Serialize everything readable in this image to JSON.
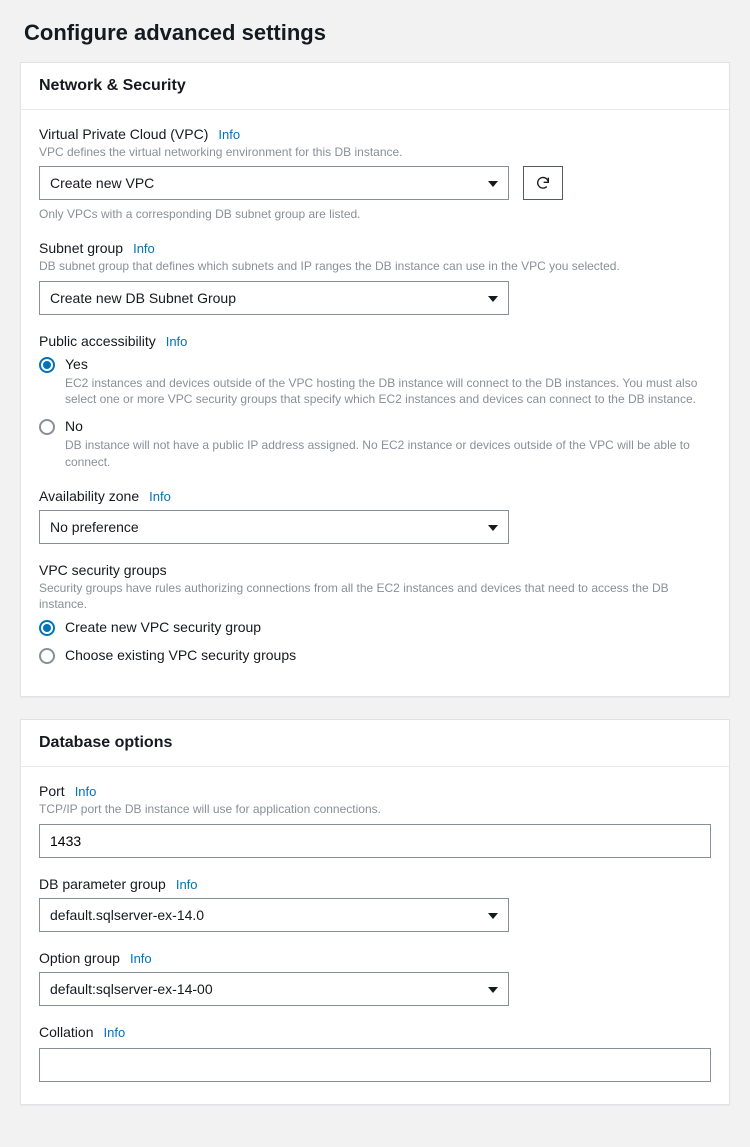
{
  "page": {
    "title": "Configure advanced settings"
  },
  "network": {
    "panel_title": "Network & Security",
    "vpc": {
      "label": "Virtual Private Cloud (VPC)",
      "info": "Info",
      "desc": "VPC defines the virtual networking environment for this DB instance.",
      "value": "Create new VPC",
      "hint": "Only VPCs with a corresponding DB subnet group are listed."
    },
    "subnet": {
      "label": "Subnet group",
      "info": "Info",
      "desc": "DB subnet group that defines which subnets and IP ranges the DB instance can use in the VPC you selected.",
      "value": "Create new DB Subnet Group"
    },
    "public": {
      "label": "Public accessibility",
      "info": "Info",
      "yes_label": "Yes",
      "yes_desc": "EC2 instances and devices outside of the VPC hosting the DB instance will connect to the DB instances. You must also select one or more VPC security groups that specify which EC2 instances and devices can connect to the DB instance.",
      "no_label": "No",
      "no_desc": "DB instance will not have a public IP address assigned. No EC2 instance or devices outside of the VPC will be able to connect."
    },
    "az": {
      "label": "Availability zone",
      "info": "Info",
      "value": "No preference"
    },
    "sg": {
      "label": "VPC security groups",
      "desc": "Security groups have rules authorizing connections from all the EC2 instances and devices that need to access the DB instance.",
      "create_label": "Create new VPC security group",
      "choose_label": "Choose existing VPC security groups"
    }
  },
  "db": {
    "panel_title": "Database options",
    "port": {
      "label": "Port",
      "info": "Info",
      "desc": "TCP/IP port the DB instance will use for application connections.",
      "value": "1433"
    },
    "param": {
      "label": "DB parameter group",
      "info": "Info",
      "value": "default.sqlserver-ex-14.0"
    },
    "option": {
      "label": "Option group",
      "info": "Info",
      "value": "default:sqlserver-ex-14-00"
    },
    "collation": {
      "label": "Collation",
      "info": "Info",
      "value": ""
    }
  }
}
